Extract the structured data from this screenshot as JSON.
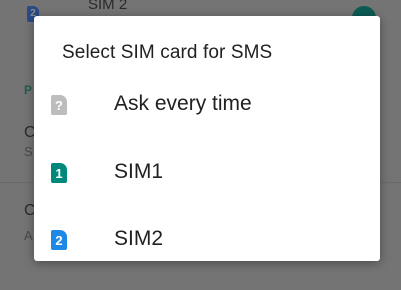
{
  "background": {
    "top_item_label": "SIM 2",
    "top_item_badge": "2",
    "section_header": "P",
    "item1_title": "C",
    "item1_sub": "S",
    "item2_title": "C",
    "item2_sub": "A"
  },
  "dialog": {
    "title": "Select SIM card for SMS",
    "options": [
      {
        "label": "Ask every time",
        "icon": "question-icon",
        "icon_text": "?",
        "color": "#bdbdbd"
      },
      {
        "label": "SIM1",
        "icon": "sim1-icon",
        "icon_text": "1",
        "color": "#00897b"
      },
      {
        "label": "SIM2",
        "icon": "sim2-icon",
        "icon_text": "2",
        "color": "#1e88e5"
      }
    ]
  },
  "colors": {
    "scrim": "#747474",
    "dialog_bg": "#ffffff",
    "toggle": "#0c5b53"
  }
}
